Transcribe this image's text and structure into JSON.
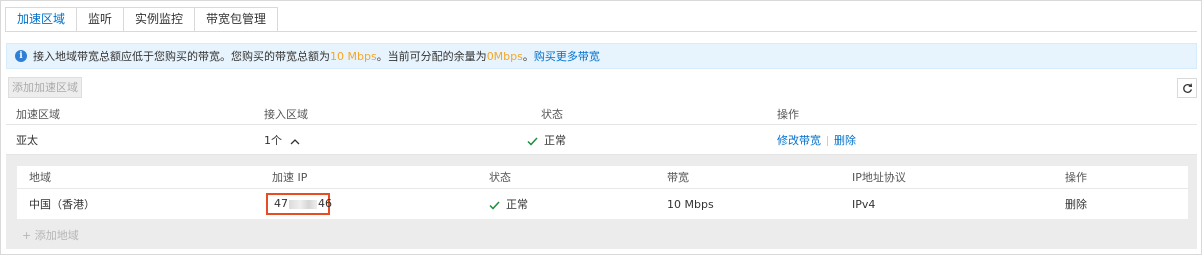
{
  "tabs": [
    {
      "label": "加速区域",
      "active": true
    },
    {
      "label": "监听",
      "active": false
    },
    {
      "label": "实例监控",
      "active": false
    },
    {
      "label": "带宽包管理",
      "active": false
    }
  ],
  "notice": {
    "text1": "接入地域带宽总额应低于您购买的带宽。您购买的带宽总额为",
    "bandwidth_total": "10 Mbps",
    "text2": "。当前可分配的余量为",
    "remaining": "0Mbps",
    "text3": "。",
    "link": "购买更多带宽"
  },
  "toolbar": {
    "add_region_label": "添加加速区域",
    "refresh_icon": "refresh-icon"
  },
  "main_table": {
    "headers": [
      "加速区域",
      "接入区域",
      "状态",
      "操作"
    ],
    "row": {
      "region": "亚太",
      "access_count": "1个",
      "status": "正常",
      "action_modify": "修改带宽",
      "action_delete": "删除"
    }
  },
  "sub_table": {
    "headers": [
      "地域",
      "加速 IP",
      "状态",
      "带宽",
      "IP地址协议",
      "操作"
    ],
    "row": {
      "region": "中国（香港）",
      "ip_prefix": "47",
      "ip_suffix": "46",
      "status": "正常",
      "bandwidth": "10 Mbps",
      "protocol": "IPv4",
      "action_delete": "删除"
    },
    "add_area_label": "添加地域"
  },
  "colors": {
    "accent": "#0070cc",
    "highlight": "#f5a623",
    "success": "#1e8e3e",
    "annotation": "#e84c22"
  }
}
